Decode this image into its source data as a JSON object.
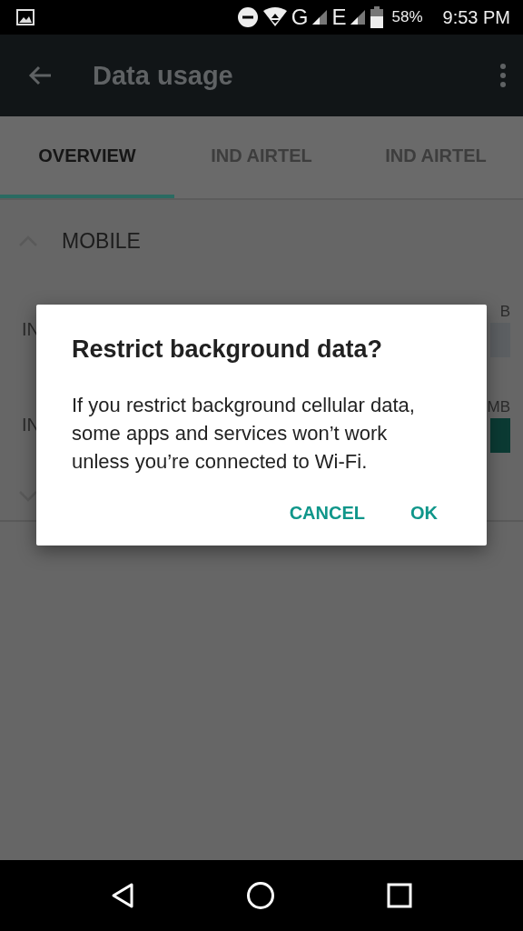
{
  "status_bar": {
    "network_1": "G",
    "network_2": "E",
    "battery": "58%",
    "time": "9:53 PM"
  },
  "toolbar": {
    "title": "Data usage"
  },
  "tabs": [
    {
      "label": "OVERVIEW",
      "selected": true
    },
    {
      "label": "IND AIRTEL",
      "selected": false
    },
    {
      "label": "IND AIRTEL",
      "selected": false
    }
  ],
  "section": {
    "title": "MOBILE",
    "expanded": true
  },
  "rows": [
    {
      "label": "IN",
      "value": "B",
      "color": "#5c5f62"
    },
    {
      "label": "IN",
      "value": "MB",
      "color": "#0b3a33"
    }
  ],
  "dialog": {
    "title": "Restrict background data?",
    "message": "If you restrict background cellular data, some apps and services won’t work unless you’re connected to Wi-Fi.",
    "buttons": [
      "CANCEL",
      "OK"
    ]
  }
}
